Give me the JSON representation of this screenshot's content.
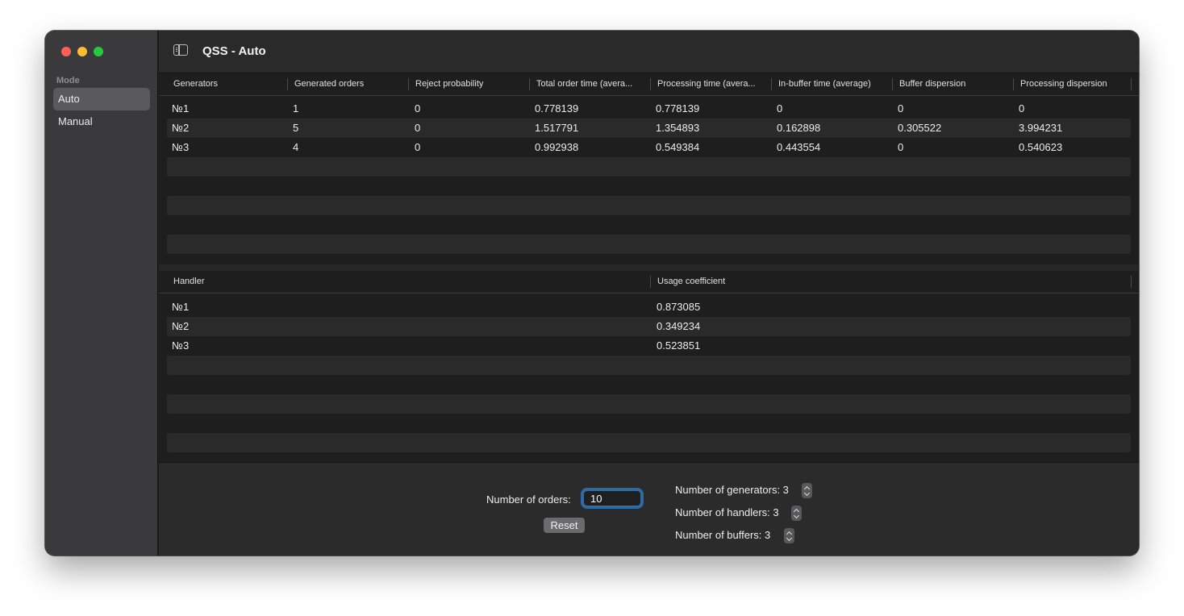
{
  "sidebar": {
    "section_label": "Mode",
    "items": [
      {
        "label": "Auto",
        "active": true
      },
      {
        "label": "Manual",
        "active": false
      }
    ]
  },
  "window": {
    "title": "QSS - Auto"
  },
  "generators_table": {
    "columns": [
      "Generators",
      "Generated orders",
      "Reject probability",
      "Total order time (avera...",
      "Processing time (avera...",
      "In-buffer time (average)",
      "Buffer dispersion",
      "Processing dispersion"
    ],
    "rows": [
      [
        "№1",
        "1",
        "0",
        "0.778139",
        "0.778139",
        "0",
        "0",
        "0"
      ],
      [
        "№2",
        "5",
        "0",
        "1.517791",
        "1.354893",
        "0.162898",
        "0.305522",
        "3.994231"
      ],
      [
        "№3",
        "4",
        "0",
        "0.992938",
        "0.549384",
        "0.443554",
        "0",
        "0.540623"
      ]
    ]
  },
  "handlers_table": {
    "columns": [
      "Handler",
      "Usage coefficient"
    ],
    "rows": [
      [
        "№1",
        "0.873085"
      ],
      [
        "№2",
        "0.349234"
      ],
      [
        "№3",
        "0.523851"
      ]
    ]
  },
  "controls": {
    "orders_label": "Number of orders:",
    "orders_value": "10",
    "reset_label": "Reset",
    "generators_label": "Number of generators: 3",
    "handlers_label": "Number of handlers: 3",
    "buffers_label": "Number of buffers: 3"
  },
  "colors": {
    "accent": "#2d6aa8",
    "close": "#fe5f57",
    "minimize": "#febc2e",
    "maximize": "#28c840"
  }
}
